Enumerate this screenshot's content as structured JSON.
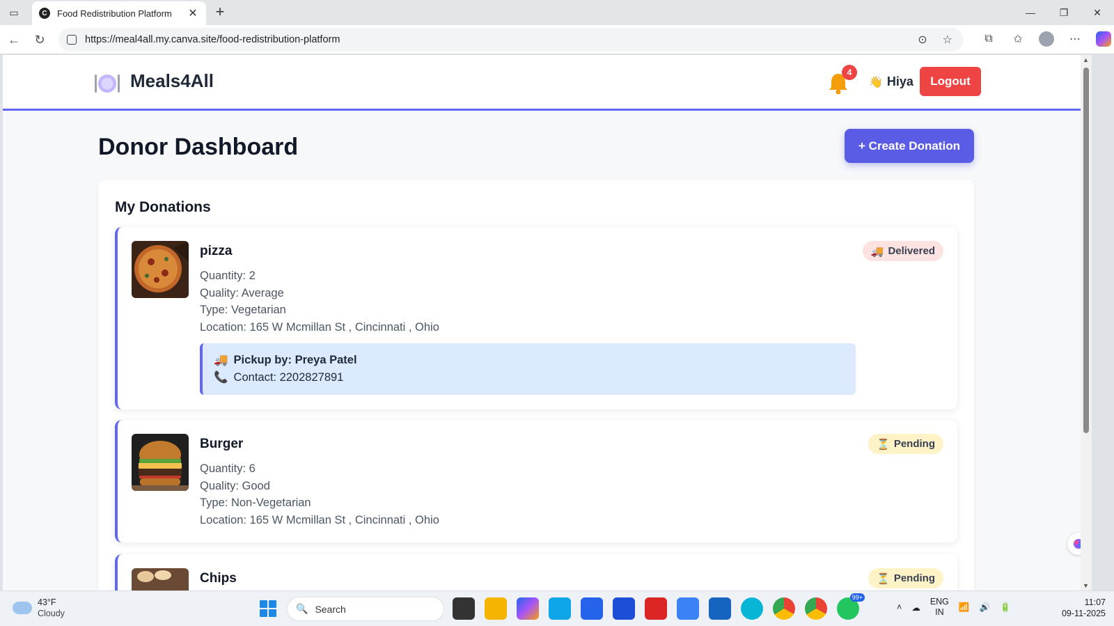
{
  "browser": {
    "tab_title": "Food Redistribution Platform",
    "url": "https://meal4all.my.canva.site/food-redistribution-platform"
  },
  "header": {
    "logo_text": "Meals4All",
    "notification_count": "4",
    "greeting": "Hiya",
    "logout_label": "Logout"
  },
  "dashboard": {
    "title": "Donor Dashboard",
    "create_label": "+ Create Donation",
    "section_title": "My Donations"
  },
  "donations": [
    {
      "name": "pizza",
      "quantity": "Quantity: 2",
      "quality": "Quality: Average",
      "type": "Type: Vegetarian",
      "location": "Location: 165 W Mcmillan St , Cincinnati , Ohio",
      "status": "Delivered",
      "status_icon": "truck-icon",
      "pickup_by": "Pickup by: Preya Patel",
      "contact": "Contact: 2202827891"
    },
    {
      "name": "Burger",
      "quantity": "Quantity: 6",
      "quality": "Quality: Good",
      "type": "Type: Non-Vegetarian",
      "location": "Location: 165 W Mcmillan St , Cincinnati , Ohio",
      "status": "Pending",
      "status_icon": "hourglass-icon"
    },
    {
      "name": "Chips",
      "status": "Pending",
      "status_icon": "hourglass-icon"
    }
  ],
  "taskbar": {
    "temperature": "43°F",
    "weather": "Cloudy",
    "search_placeholder": "Search",
    "lang_line1": "ENG",
    "lang_line2": "IN",
    "time": "11:07",
    "date": "09-11-2025",
    "whatsapp_badge": "99+"
  },
  "colors": {
    "accent": "#6366f1",
    "logout": "#ef4444",
    "create": "#5b5ce6",
    "delivered_bg": "#fde2e2",
    "pending_bg": "#fef3c7",
    "pickup_bg": "#dbeafe"
  }
}
